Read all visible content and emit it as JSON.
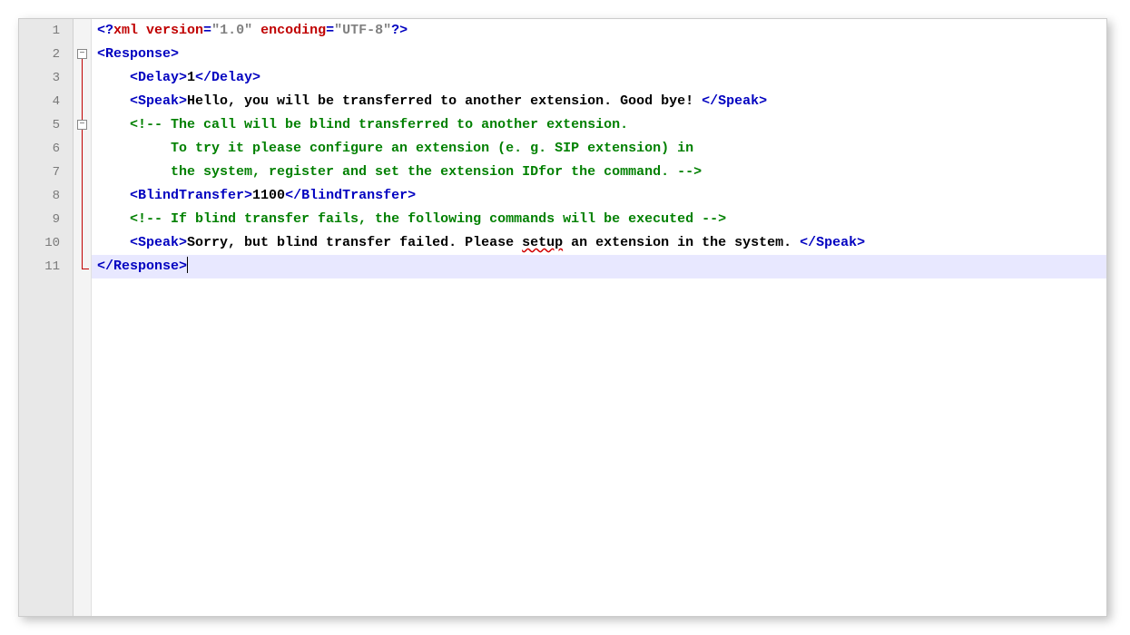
{
  "lines": {
    "n1": "1",
    "n2": "2",
    "n3": "3",
    "n4": "4",
    "n5": "5",
    "n6": "6",
    "n7": "7",
    "n8": "8",
    "n9": "9",
    "n10": "10",
    "n11": "11"
  },
  "fold": {
    "minus1": "−",
    "minus2": "−"
  },
  "code": {
    "l1": {
      "p1": "<?",
      "p2": "xml version",
      "p3": "=",
      "p4": "\"1.0\"",
      "p5": " encoding",
      "p6": "=",
      "p7": "\"UTF-8\"",
      "p8": "?>"
    },
    "l2": {
      "open": "<Response>"
    },
    "l3": {
      "open": "<Delay>",
      "val": "1",
      "close": "</Delay>"
    },
    "l4": {
      "open": "<Speak>",
      "val": "Hello, you will be transferred to another extension. Good bye! ",
      "close": "</Speak>"
    },
    "l5": {
      "c": "<!-- The call will be blind transferred to another extension."
    },
    "l6": {
      "c": "To try it please configure an extension (e. g. SIP extension) in"
    },
    "l7": {
      "c": "the system, register and set the extension IDfor the command. -->"
    },
    "l8": {
      "open": "<BlindTransfer>",
      "val": "1100",
      "close": "</BlindTransfer>"
    },
    "l9": {
      "c": "<!-- If blind transfer fails, the following commands will be executed -->"
    },
    "l10": {
      "open": "<Speak>",
      "v1": "Sorry, but blind transfer failed. Please ",
      "v2": "setup",
      "v3": " an extension in the system. ",
      "close": "</Speak>"
    },
    "l11": {
      "close": "</Response>"
    }
  }
}
